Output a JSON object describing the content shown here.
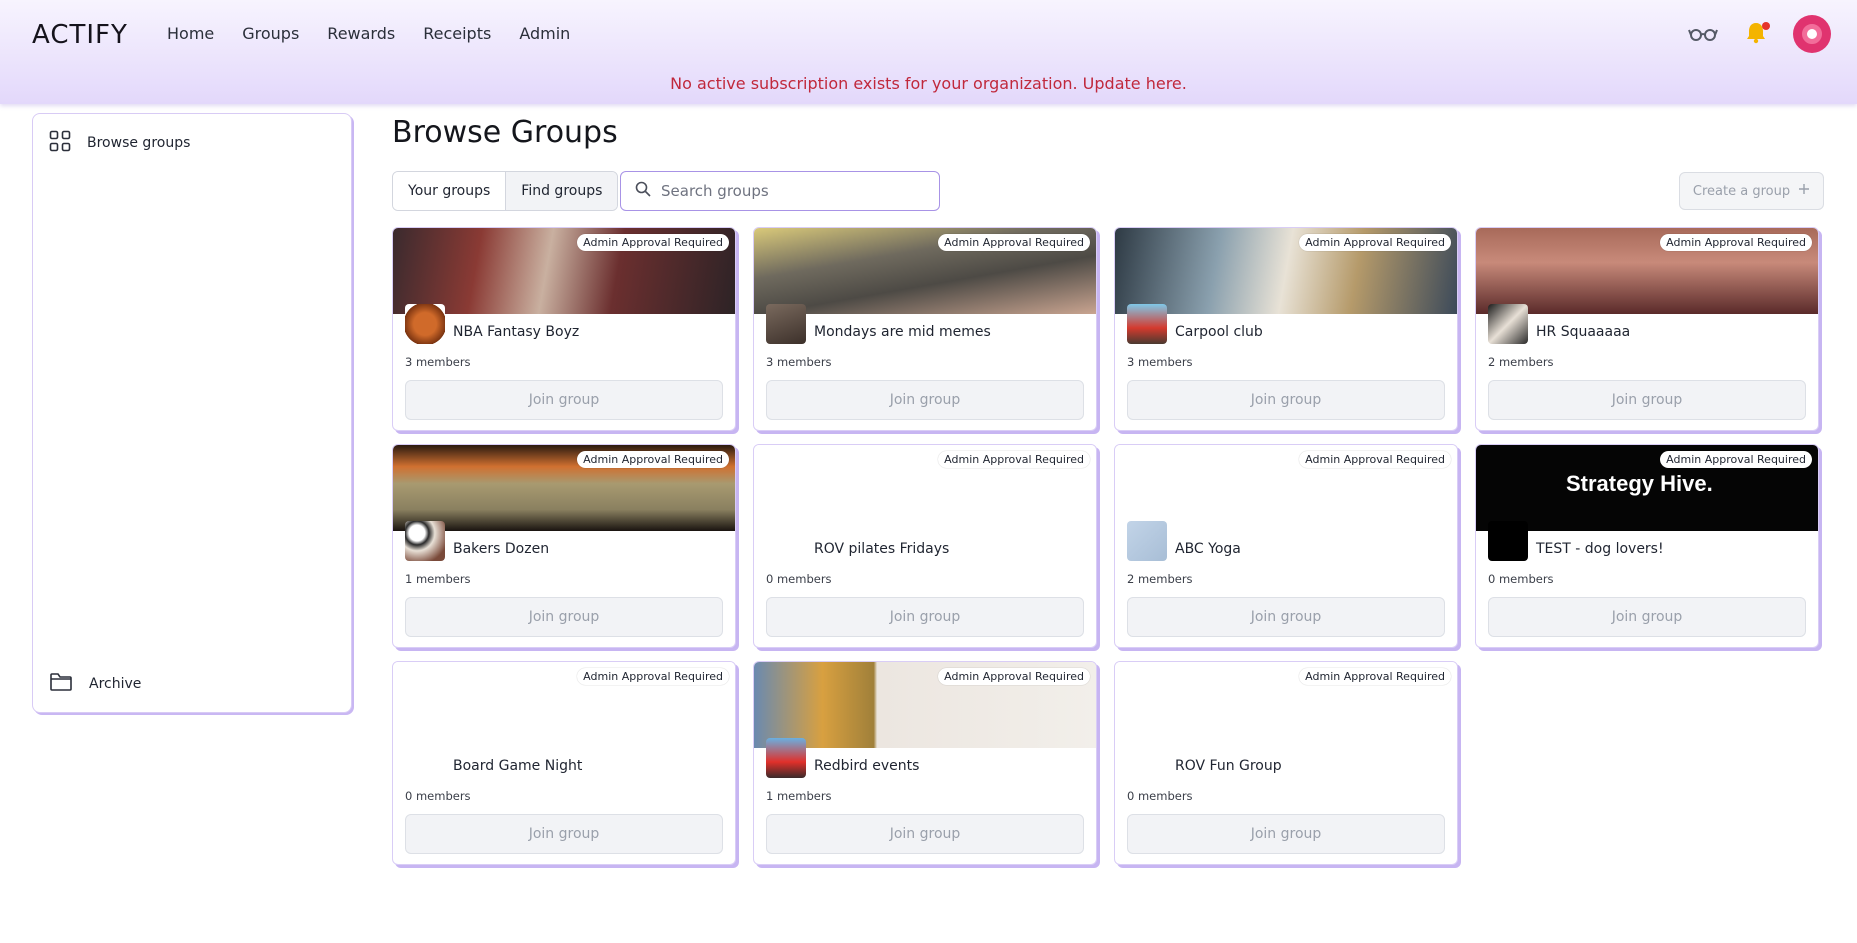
{
  "header": {
    "logo": "ACTIFY",
    "nav": [
      "Home",
      "Groups",
      "Rewards",
      "Receipts",
      "Admin"
    ],
    "banner": "No active subscription exists for your organization. Update here.",
    "icons": [
      "glasses-icon",
      "bell-icon",
      "avatar"
    ]
  },
  "sidebar": {
    "browse_label": "Browse groups",
    "archive_label": "Archive"
  },
  "main": {
    "title": "Browse Groups",
    "tabs": [
      "Your groups",
      "Find groups"
    ],
    "search_placeholder": "Search groups",
    "create_label": "Create a group"
  },
  "cards": [
    {
      "name": "NBA Fantasy Boyz",
      "members": "3 members",
      "badge": "Admin Approval Required",
      "join": "Join group",
      "cover": "linear-gradient(100deg,#3a2a2e 0%,#8a3a34 25%,#c9b0a0 45%,#6b2f2f 65%,#2d2326 100%)",
      "thumb": "radial-gradient(circle,#d06a2a 40%,#7a3310 75%,#fff 76%)"
    },
    {
      "name": "Mondays are mid memes",
      "members": "3 members",
      "badge": "Admin Approval Required",
      "join": "Join group",
      "cover": "linear-gradient(170deg,#d9c97a 0%,#6f6a5e 35%,#4d4a45 60%,#c9a490 100%)",
      "thumb": "linear-gradient(160deg,#7a6a5e,#3c302a)"
    },
    {
      "name": "Carpool club",
      "members": "3 members",
      "badge": "Admin Approval Required",
      "join": "Join group",
      "cover": "linear-gradient(100deg,#2e3a44 0%,#8aa0ae 30%,#e8e2d6 50%,#b59a6a 70%,#3c4a5a 100%)",
      "thumb": "linear-gradient(180deg,#7fc8e8 0%,#d43a2e 60%,#4a3a30 100%)"
    },
    {
      "name": "HR Squaaaaa",
      "members": "2 members",
      "badge": "Admin Approval Required",
      "join": "Join group",
      "cover": "linear-gradient(180deg,#a86a5a 0%,#c88a7a 40%,#5a2a2a 100%)",
      "thumb": "linear-gradient(135deg,#1a1a1a,#e8e0d6,#2a2a2a)"
    },
    {
      "name": "Bakers Dozen",
      "members": "1 members",
      "badge": "Admin Approval Required",
      "join": "Join group",
      "cover": "linear-gradient(180deg,#2a1a10 0%,#d07030 25%,#a89a70 45%,#8a8060 75%,#1a1410 100%)",
      "thumb": "radial-gradient(circle at 30% 30%,#fff 20%,#2a2a2a 30%,#e8e0d6 45%,#7a4a3a 80%)"
    },
    {
      "name": "ROV pilates Fridays",
      "members": "0 members",
      "badge": "Admin Approval Required",
      "join": "Join group",
      "cover": "#ffffff",
      "thumb": "#ffffff"
    },
    {
      "name": "ABC Yoga",
      "members": "2 members",
      "badge": "Admin Approval Required",
      "join": "Join group",
      "cover": "#ffffff",
      "thumb": "linear-gradient(135deg,#c2d4e8,#a8bed6)"
    },
    {
      "name": "TEST - dog lovers!",
      "members": "0 members",
      "badge": "Admin Approval Required",
      "join": "Join group",
      "cover": "#050505",
      "thumb": "#000000",
      "cover_text": "Strategy Hive."
    },
    {
      "name": "Board Game Night",
      "members": "0 members",
      "badge": "Admin Approval Required",
      "join": "Join group",
      "cover": "#ffffff",
      "thumb": "#ffffff"
    },
    {
      "name": "Redbird events",
      "members": "1 members",
      "badge": "Admin Approval Required",
      "join": "Join group",
      "cover": "linear-gradient(90deg,#6a8ab0 0%,#d8a040 20%,#a0803a 35%,#ece6e0 36%,#f2efea 100%)",
      "thumb": "linear-gradient(180deg,#6ab0e0 0%,#e0302a 60%,#3a2a2a 100%)"
    },
    {
      "name": "ROV Fun Group",
      "members": "0 members",
      "badge": "Admin Approval Required",
      "join": "Join group",
      "cover": "#ffffff",
      "thumb": "#ffffff"
    }
  ]
}
